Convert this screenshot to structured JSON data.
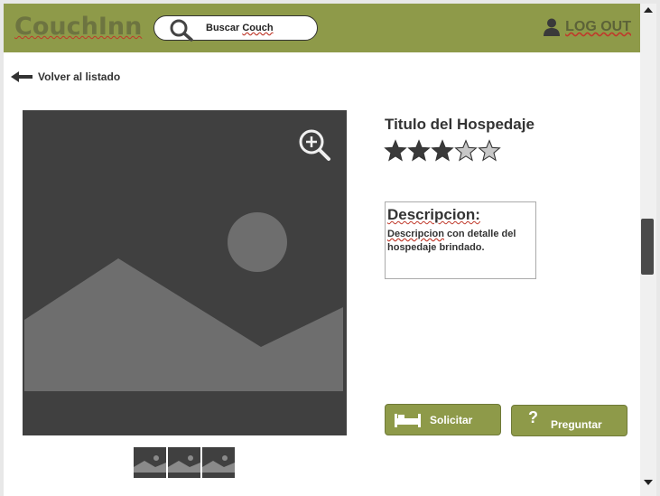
{
  "app": {
    "logo": "CouchInn",
    "search_prefix": "Buscar",
    "search_word": "Couch",
    "logout_label": "LOG OUT"
  },
  "nav": {
    "back_label": "Volver al listado"
  },
  "listing": {
    "title": "Titulo del Hospedaje",
    "rating": 3,
    "rating_max": 5,
    "description_title": "Descripcion:",
    "description_first_word": "Descripcion",
    "description_rest": " con detalle del hospedaje brindado."
  },
  "actions": {
    "solicitar_label": "Solicitar",
    "preguntar_icon": "?",
    "preguntar_label": "Preguntar"
  },
  "icons": {
    "search": "search-icon",
    "user": "user-icon",
    "back": "arrow-left-icon",
    "zoom": "zoom-in-icon",
    "bed": "bed-icon",
    "image": "image-placeholder-icon"
  },
  "colors": {
    "brand": "#8e9a49",
    "image_bg": "#404040"
  }
}
